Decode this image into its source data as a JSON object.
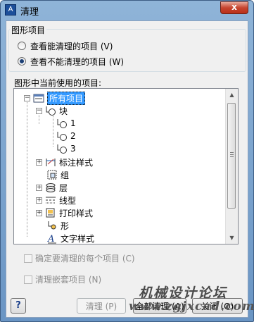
{
  "window": {
    "title": "清理",
    "close_glyph": "x"
  },
  "group": {
    "label": "图形项目",
    "options": [
      {
        "label": "查看能清理的项目 (V)",
        "selected": false
      },
      {
        "label": "查看不能清理的项目 (W)",
        "selected": true
      }
    ]
  },
  "tree": {
    "label": "图形中当前使用的项目:",
    "root": "所有项目",
    "items": {
      "block": "块",
      "b1": "1",
      "b2": "2",
      "b3": "3",
      "dimstyle": "标注样式",
      "group": "组",
      "layer": "层",
      "linetype": "线型",
      "plotstyle": "打印样式",
      "shape": "形",
      "textstyle": "文字样式"
    }
  },
  "checks": {
    "confirm": "确定要清理的每个项目 (C)",
    "nested": "清理嵌套项目 (N)"
  },
  "buttons": {
    "help": "?",
    "purge": "清理 (P)",
    "purge_all": "全部清理 (A)",
    "close": "关闭 (O)"
  },
  "watermark": {
    "line1": "机械设计论坛",
    "line2": "www.zgjxcad.com"
  }
}
